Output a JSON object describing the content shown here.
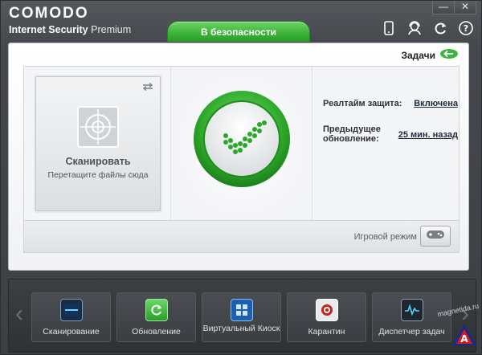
{
  "app": {
    "logo": "COMODO",
    "product_bold": "Internet Security",
    "product_light": "Premium"
  },
  "window_controls": {
    "minimize": "—",
    "close": "✕"
  },
  "top_icons": [
    "phone-icon",
    "support-icon",
    "refresh-icon",
    "help-icon"
  ],
  "status_tab": "В безопасности",
  "tasks_link": "Задачи",
  "scan_tile": {
    "title": "Сканировать",
    "subtitle": "Перетащите файлы сюда"
  },
  "info": {
    "realtime_label": "Реалтайм защита:",
    "realtime_value": "Включена",
    "last_update_label": "Предыдущее обновление:",
    "last_update_value": "25 мин. назад"
  },
  "game_mode": {
    "label": "Игровой режим"
  },
  "dock": {
    "tiles": [
      {
        "label": "Сканирование",
        "icon": "scan-icon"
      },
      {
        "label": "Обновление",
        "icon": "update-icon"
      },
      {
        "label": "Виртуальный Киоск",
        "icon": "kiosk-icon"
      },
      {
        "label": "Карантин",
        "icon": "quarantine-icon"
      },
      {
        "label": "Диспетчер задач",
        "icon": "task-manager-icon"
      }
    ]
  },
  "watermark": "magnetida.ru",
  "colors": {
    "accent_green": "#3db53a",
    "dark_chrome": "#3c3f43"
  }
}
